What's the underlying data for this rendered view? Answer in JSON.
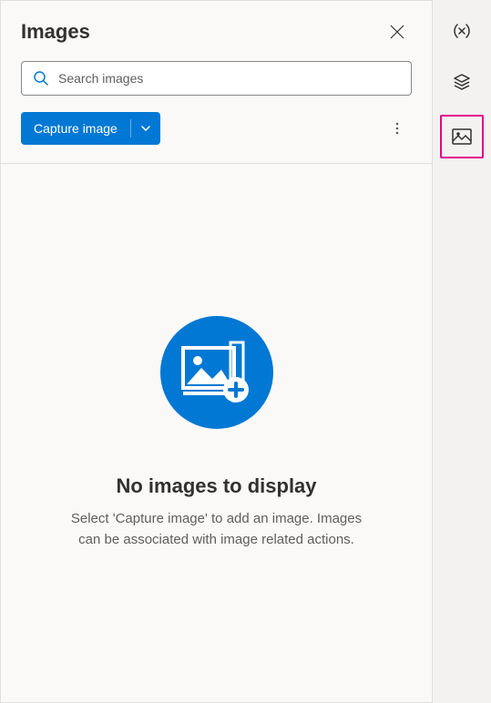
{
  "header": {
    "title": "Images"
  },
  "search": {
    "placeholder": "Search images"
  },
  "toolbar": {
    "capture_label": "Capture image"
  },
  "empty_state": {
    "title": "No images to display",
    "subtitle": "Select 'Capture image' to add an image. Images can be associated with image related actions."
  },
  "rail": {
    "items": [
      {
        "name": "variables",
        "selected": false
      },
      {
        "name": "layers",
        "selected": false
      },
      {
        "name": "images",
        "selected": true
      }
    ]
  }
}
